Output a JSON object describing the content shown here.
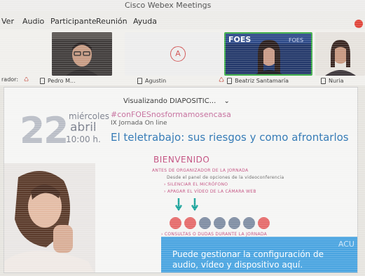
{
  "window": {
    "title": "Cisco Webex Meetings"
  },
  "menu": [
    "Ver",
    "Audio",
    "Participante",
    "Reunión",
    "Ayuda"
  ],
  "participants": [
    {
      "label": "Pedro M..."
    },
    {
      "label": "Agustin",
      "initial": "A"
    },
    {
      "label": "Beatriz Santamaría",
      "slide_text": "FOES"
    },
    {
      "label": "Nuria"
    }
  ],
  "strip_left_text": "rador:",
  "sharing": {
    "label": "Visualizando DIAPOSITIC..."
  },
  "slide": {
    "day_number": "22",
    "weekday": "miércoles",
    "month": "abril",
    "time": "10:00 h.",
    "hashtag": "#conFOESnosformamosencasa",
    "jornada": "IX Jornada On line",
    "headline": "El teletrabajo: sus riesgos y como afrontarlos",
    "welcome": "BIENVENIDO",
    "instructions": [
      "ANTES DE ORGANIZADOR DE LA JORNADA",
      "Desde el panel de opciones de la videoconferencia",
      "› SILENCIAR EL MICRÓFONO",
      "› APAGAR EL VÍDEO DE LA CÁMARA WEB"
    ],
    "questions": "› CONSULTAS O DUDAS DURANTE LA JORNADA",
    "banner": "Puede gestionar la configuración de audio, vídeo y dispositivo aquí.",
    "banner_tag": "ACU",
    "control_colors": [
      "#e56a6a",
      "#e56a6a",
      "#7f8da3",
      "#7f8da3",
      "#7f8da3",
      "#7f8da3",
      "#e56a6a"
    ],
    "accent": "#2c75b3"
  }
}
